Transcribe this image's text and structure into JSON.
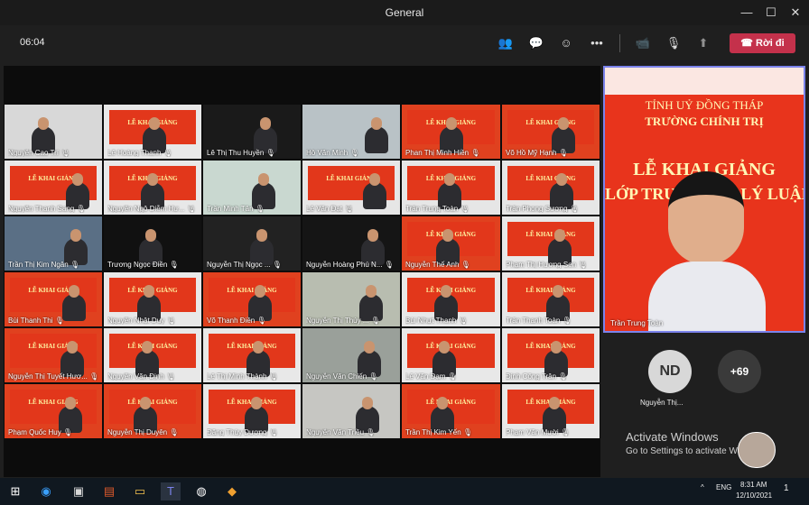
{
  "window": {
    "title": "General",
    "minimize": "—",
    "maximize": "☐",
    "close": "✕"
  },
  "toolbar": {
    "timer": "06:04",
    "leave_label": "Rời đi",
    "icons": {
      "people": "👥",
      "chat": "💬",
      "reactions": "☺",
      "more": "•••",
      "camera": "📹",
      "mic": "🎙",
      "share": "⬆"
    }
  },
  "tiles": [
    {
      "name": "Nguyễn Cao Trí",
      "banner": false,
      "bg": "#d8d8d8"
    },
    {
      "name": "Lê Hoàng Thanh",
      "banner": true,
      "btext": "LỄ KHAI GIẢNG",
      "bg": "#e8e8e8"
    },
    {
      "name": "Lê Thị Thu Huyền",
      "banner": false,
      "bg": "#1a1a1a"
    },
    {
      "name": "Hồ Văn Minh",
      "banner": false,
      "bg": "#b9c2c6"
    },
    {
      "name": "Phan Thị Minh Hiền",
      "banner": true,
      "btext": "LỄ KHAI GIẢNG",
      "bg": "#e0411f"
    },
    {
      "name": "Võ Hồ Mỹ Hạnh",
      "banner": true,
      "btext": "LỄ KHAI GIẢNG",
      "bg": "#e0411f"
    },
    {
      "name": "Nguyễn Thanh Sang",
      "banner": true,
      "btext": "LỄ KHAI GIẢNG",
      "bg": "#e8e8e8"
    },
    {
      "name": "Nguyễn Ngô Diễm Hư...",
      "banner": true,
      "btext": "LỄ KHAI GIẢNG",
      "bg": "#e8e8e8"
    },
    {
      "name": "Trần Minh Tân",
      "banner": false,
      "bg": "#c9d8d0"
    },
    {
      "name": "Lê Văn Đạt",
      "banner": true,
      "btext": "LỄ KHAI GIẢNG",
      "bg": "#e6e6e6"
    },
    {
      "name": "Trần Trung Toàn",
      "banner": true,
      "btext": "LỄ KHAI GIẢNG",
      "bg": "#e6e6e6"
    },
    {
      "name": "Trần Phong Sương",
      "banner": true,
      "btext": "LỄ KHAI GIẢNG",
      "bg": "#e6e6e6"
    },
    {
      "name": "Trần Thị Kim Ngân",
      "banner": false,
      "bg": "#5a6f85"
    },
    {
      "name": "Trương Ngọc Điền",
      "banner": false,
      "bg": "#111111"
    },
    {
      "name": "Nguyễn Thị Ngọc ...",
      "banner": false,
      "bg": "#222222"
    },
    {
      "name": "Nguyễn Hoàng Phú N...",
      "banner": false,
      "bg": "#151515"
    },
    {
      "name": "Nguyễn Thế Anh",
      "banner": true,
      "btext": "LỄ KHAI GIẢNG",
      "bg": "#e0411f"
    },
    {
      "name": "Phạm Thị Hương Sen",
      "banner": true,
      "btext": "LỄ KHAI GIẢNG",
      "bg": "#e8e8e8"
    },
    {
      "name": "Bùi Thanh Thi",
      "banner": true,
      "btext": "LỄ KHAI GIẢNG",
      "bg": "#e0411f"
    },
    {
      "name": "Nguyễn Nhật Duy",
      "banner": true,
      "btext": "LỄ KHAI GIẢNG",
      "bg": "#e8e8e8"
    },
    {
      "name": "Võ Thanh Điền",
      "banner": true,
      "btext": "LỄ KHAI GIẢNG",
      "bg": "#e0411f"
    },
    {
      "name": "Nguyễn Thị Thúy ...",
      "banner": false,
      "bg": "#b8bdb0"
    },
    {
      "name": "Bùi Nhựt Thanh",
      "banner": true,
      "btext": "LỄ KHAI GIẢNG",
      "bg": "#e8e8e8"
    },
    {
      "name": "Trần Thanh Toàn",
      "banner": true,
      "btext": "LỄ KHAI GIẢNG",
      "bg": "#e8e8e8"
    },
    {
      "name": "Nguyễn Thị Tuyết Hươ...",
      "banner": true,
      "btext": "LỄ KHAI GIẢNG",
      "bg": "#e0411f"
    },
    {
      "name": "Nguyễn Văn Định",
      "banner": true,
      "btext": "LỄ KHAI GIẢNG",
      "bg": "#e8e8e8"
    },
    {
      "name": "Lê Thị Minh Thành",
      "banner": true,
      "btext": "LỄ KHAI GIẢNG",
      "bg": "#e8e8e8"
    },
    {
      "name": "Nguyễn Văn Chiến",
      "banner": false,
      "bg": "#9aa09a"
    },
    {
      "name": "Lê Văn Đạm",
      "banner": true,
      "btext": "LỄ KHAI GIẢNG",
      "bg": "#e8e8e8"
    },
    {
      "name": "Đinh Công Trân",
      "banner": true,
      "btext": "LỄ KHAI GIẢNG",
      "bg": "#e8e8e8"
    },
    {
      "name": "Phạm Quốc Huy",
      "banner": true,
      "btext": "LỄ KHAI GIẢNG",
      "bg": "#e0411f"
    },
    {
      "name": "Nguyễn Thị Duyên",
      "banner": true,
      "btext": "LỄ KHAI GIẢNG",
      "bg": "#e0411f"
    },
    {
      "name": "Đặng Thùy Dương",
      "banner": true,
      "btext": "LỄ KHAI GIẢNG",
      "bg": "#e8e8e8"
    },
    {
      "name": "Nguyễn Văn Triều",
      "banner": false,
      "bg": "#c6c6c2"
    },
    {
      "name": "Trần Thị Kim Yến",
      "banner": true,
      "btext": "LỄ KHAI GIẢNG",
      "bg": "#e0411f"
    },
    {
      "name": "Phạm Văn Mười",
      "banner": true,
      "btext": "LỄ KHAI GIẢNG",
      "bg": "#e8e8e8"
    }
  ],
  "spotlight": {
    "line1": "TỈNH UỶ ĐỒNG THÁP",
    "line2": "TRƯỜNG CHÍNH TRỊ",
    "line3": "LỄ KHAI GIẢNG",
    "line4": "LỚP TRUNG CẤP LÝ LUẬN CHÍNH TRỊ",
    "name": "Trần Trung Toàn"
  },
  "participants": {
    "initials": "ND",
    "name": "Nguyễn Thị...",
    "more": "+69"
  },
  "watermark": {
    "line1": "Activate Windows",
    "line2": "Go to Settings to activate Windows."
  },
  "taskbar": {
    "lang": "ENG",
    "time": "8:31 AM",
    "date": "12/10/2021",
    "notif": "1"
  }
}
